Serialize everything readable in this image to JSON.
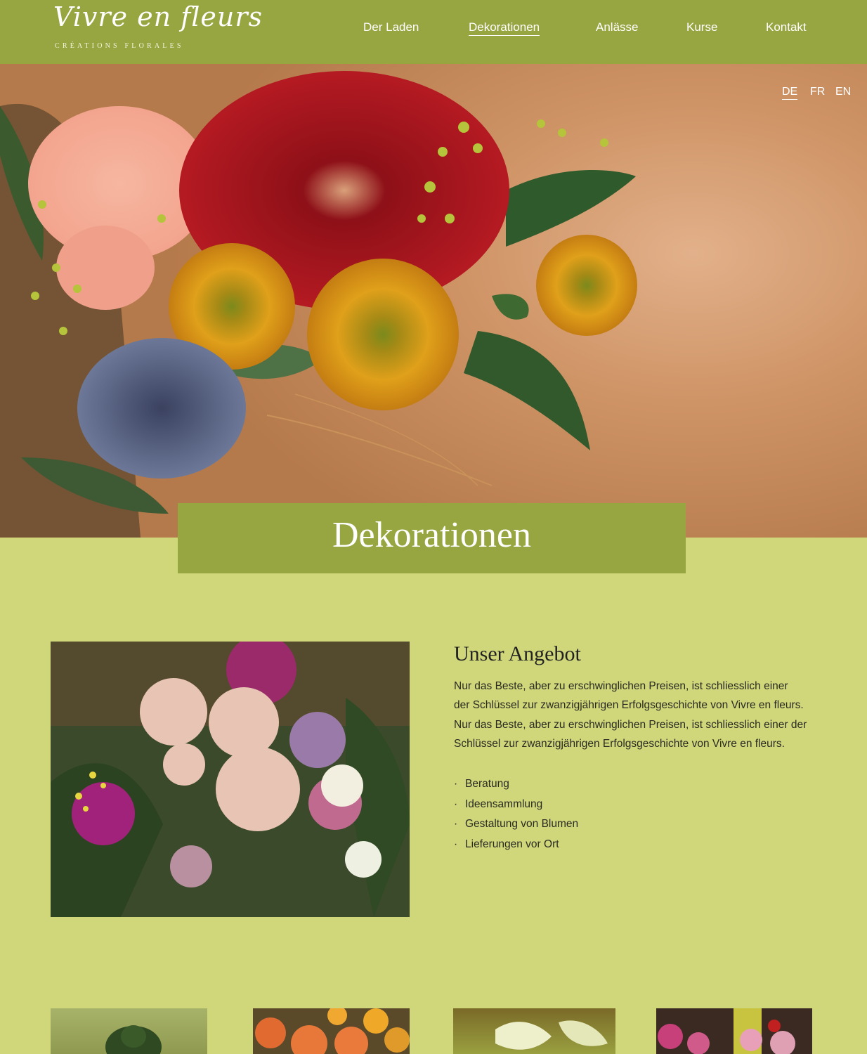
{
  "header": {
    "logo_script": "Vivre en fleurs",
    "logo_sub": "CRÉATIONS   FLORALES",
    "nav": [
      {
        "label": "Der Laden"
      },
      {
        "label": "Dekorationen"
      },
      {
        "label": "Anlässe"
      },
      {
        "label": "Kurse"
      },
      {
        "label": "Kontakt"
      }
    ],
    "active_nav": "Dekorationen"
  },
  "languages": [
    {
      "label": "DE"
    },
    {
      "label": "FR"
    },
    {
      "label": "EN"
    }
  ],
  "active_language": "DE",
  "page_title": "Dekorationen",
  "offer": {
    "title": "Unser Angebot",
    "paragraph_lines": [
      "Nur das Beste, aber zu erschwinglichen Preisen, ist schliesslich einer",
      "der Schlüssel zur zwanzigjährigen Erfolgsgeschichte von Vivre en fleurs.",
      "Nur das Beste, aber zu erschwinglichen Preisen, ist schliesslich einer der",
      "Schlüssel zur zwanzigjährigen Erfolgsgeschichte von Vivre en fleurs."
    ],
    "list": [
      "Beratung",
      "Ideensammlung",
      "Gestaltung von Blumen",
      "Lieferungen vor Ort"
    ]
  },
  "colors": {
    "header_green": "#98a641",
    "page_green": "#d0d77b",
    "text_dark": "#2a2a22"
  }
}
